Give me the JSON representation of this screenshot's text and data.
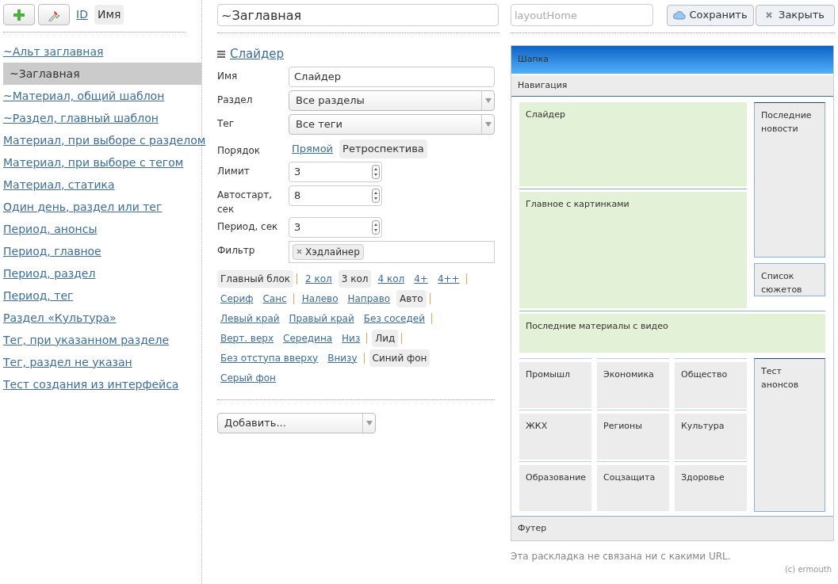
{
  "sidebar": {
    "sort": [
      {
        "label": "ID",
        "selected": false
      },
      {
        "label": "Имя",
        "selected": true
      }
    ],
    "items": [
      {
        "label": "~Альт заглавная",
        "selected": false
      },
      {
        "label": "~Заглавная",
        "selected": true
      },
      {
        "label": "~Материал, общий шаблон",
        "selected": false
      },
      {
        "label": "~Раздел, главный шаблон",
        "selected": false
      },
      {
        "label": "Материал, при выборе с разделом",
        "selected": false
      },
      {
        "label": "Материал, при выборе с тегом",
        "selected": false
      },
      {
        "label": "Материал, статика",
        "selected": false
      },
      {
        "label": "Один день, раздел или тег",
        "selected": false
      },
      {
        "label": "Период, анонсы",
        "selected": false
      },
      {
        "label": "Период, главное",
        "selected": false
      },
      {
        "label": "Период, раздел",
        "selected": false
      },
      {
        "label": "Период, тег",
        "selected": false
      },
      {
        "label": "Раздел «Культура»",
        "selected": false
      },
      {
        "label": "Тег, при указанном разделе",
        "selected": false
      },
      {
        "label": "Тег, раздел не указан",
        "selected": false
      },
      {
        "label": "Тест создания из интерфейса",
        "selected": false
      }
    ]
  },
  "editor": {
    "title": "~Заглавная",
    "layout_placeholder": "layoutHome",
    "save": "Сохранить",
    "close": "Закрыть",
    "block": {
      "title": "Слайдер",
      "fields": [
        {
          "kind": "text",
          "label": "Имя",
          "value": "Слайдер"
        },
        {
          "kind": "select",
          "label": "Раздел",
          "value": "Все разделы"
        },
        {
          "kind": "select",
          "label": "Тег",
          "value": "Все теги"
        },
        {
          "kind": "toggle",
          "label": "Порядок",
          "options": [
            {
              "label": "Прямой",
              "selected": false
            },
            {
              "label": "Ретроспектива",
              "selected": true
            }
          ]
        },
        {
          "kind": "spinner",
          "label": "Лимит",
          "value": "3"
        },
        {
          "kind": "spinner",
          "label": "Автостарт, сек",
          "value": "8"
        },
        {
          "kind": "spinner",
          "label": "Период, сек",
          "value": "3"
        },
        {
          "kind": "tags",
          "label": "Фильтр",
          "tags": [
            "Хэдлайнер"
          ]
        }
      ],
      "option_groups": [
        [
          {
            "label": "Главный блок",
            "selected": true
          }
        ],
        [
          {
            "label": "2 кол",
            "selected": false
          },
          {
            "label": "3 кол",
            "selected": true
          },
          {
            "label": "4 кол",
            "selected": false
          },
          {
            "label": "4+",
            "selected": false
          },
          {
            "label": "4++",
            "selected": false
          }
        ],
        [
          {
            "label": "Сериф",
            "selected": false
          },
          {
            "label": "Санс",
            "selected": false
          }
        ],
        [
          {
            "label": "Налево",
            "selected": false
          },
          {
            "label": "Направо",
            "selected": false
          },
          {
            "label": "Авто",
            "selected": true
          }
        ],
        [
          {
            "label": "Левый край",
            "selected": false
          },
          {
            "label": "Правый край",
            "selected": false
          },
          {
            "label": "Без соседей",
            "selected": false
          }
        ],
        [
          {
            "label": "Верт. верх",
            "selected": false
          },
          {
            "label": "Середина",
            "selected": false
          },
          {
            "label": "Низ",
            "selected": false
          }
        ],
        [
          {
            "label": "Лид",
            "selected": true
          }
        ],
        [
          {
            "label": "Без отступа вверху",
            "selected": false
          },
          {
            "label": "Внизу",
            "selected": false
          }
        ],
        [
          {
            "label": "Синий фон",
            "selected": true
          },
          {
            "label": "Серый фон",
            "selected": false
          }
        ]
      ]
    },
    "add": "Добавить..."
  },
  "preview": {
    "header": "Шапка",
    "navigation": "Навигация",
    "top": {
      "main": [
        {
          "label": "Слайдер",
          "color": "#e3f1d6"
        },
        {
          "label": "Главное с картинками",
          "color": "#e3f1d6"
        }
      ],
      "side": [
        {
          "label": "Последние новости",
          "color": "#ececec"
        },
        {
          "label": "Список сюжетов",
          "color": "#ececec"
        }
      ]
    },
    "full": [
      {
        "label": "Последние материалы с видео",
        "color": "#e3f1d6"
      }
    ],
    "grid": {
      "cells": [
        {
          "label": "Промышл",
          "color": "#ececec"
        },
        {
          "label": "Экономика",
          "color": "#ececec"
        },
        {
          "label": "Общество",
          "color": "#ececec"
        },
        {
          "label": "ЖКХ",
          "color": "#ececec"
        },
        {
          "label": "Регионы",
          "color": "#ececec"
        },
        {
          "label": "Культура",
          "color": "#ececec"
        },
        {
          "label": "Образование",
          "color": "#ececec"
        },
        {
          "label": "Соцзащита",
          "color": "#ececec"
        },
        {
          "label": "Здоровье",
          "color": "#ececec"
        }
      ],
      "side": [
        {
          "label": "Тест анонсов",
          "color": "#ececec"
        }
      ]
    },
    "footer": "Футер",
    "note": "Эта раскладка не связана ни с какими URL."
  },
  "copyright": "(c) ermouth"
}
